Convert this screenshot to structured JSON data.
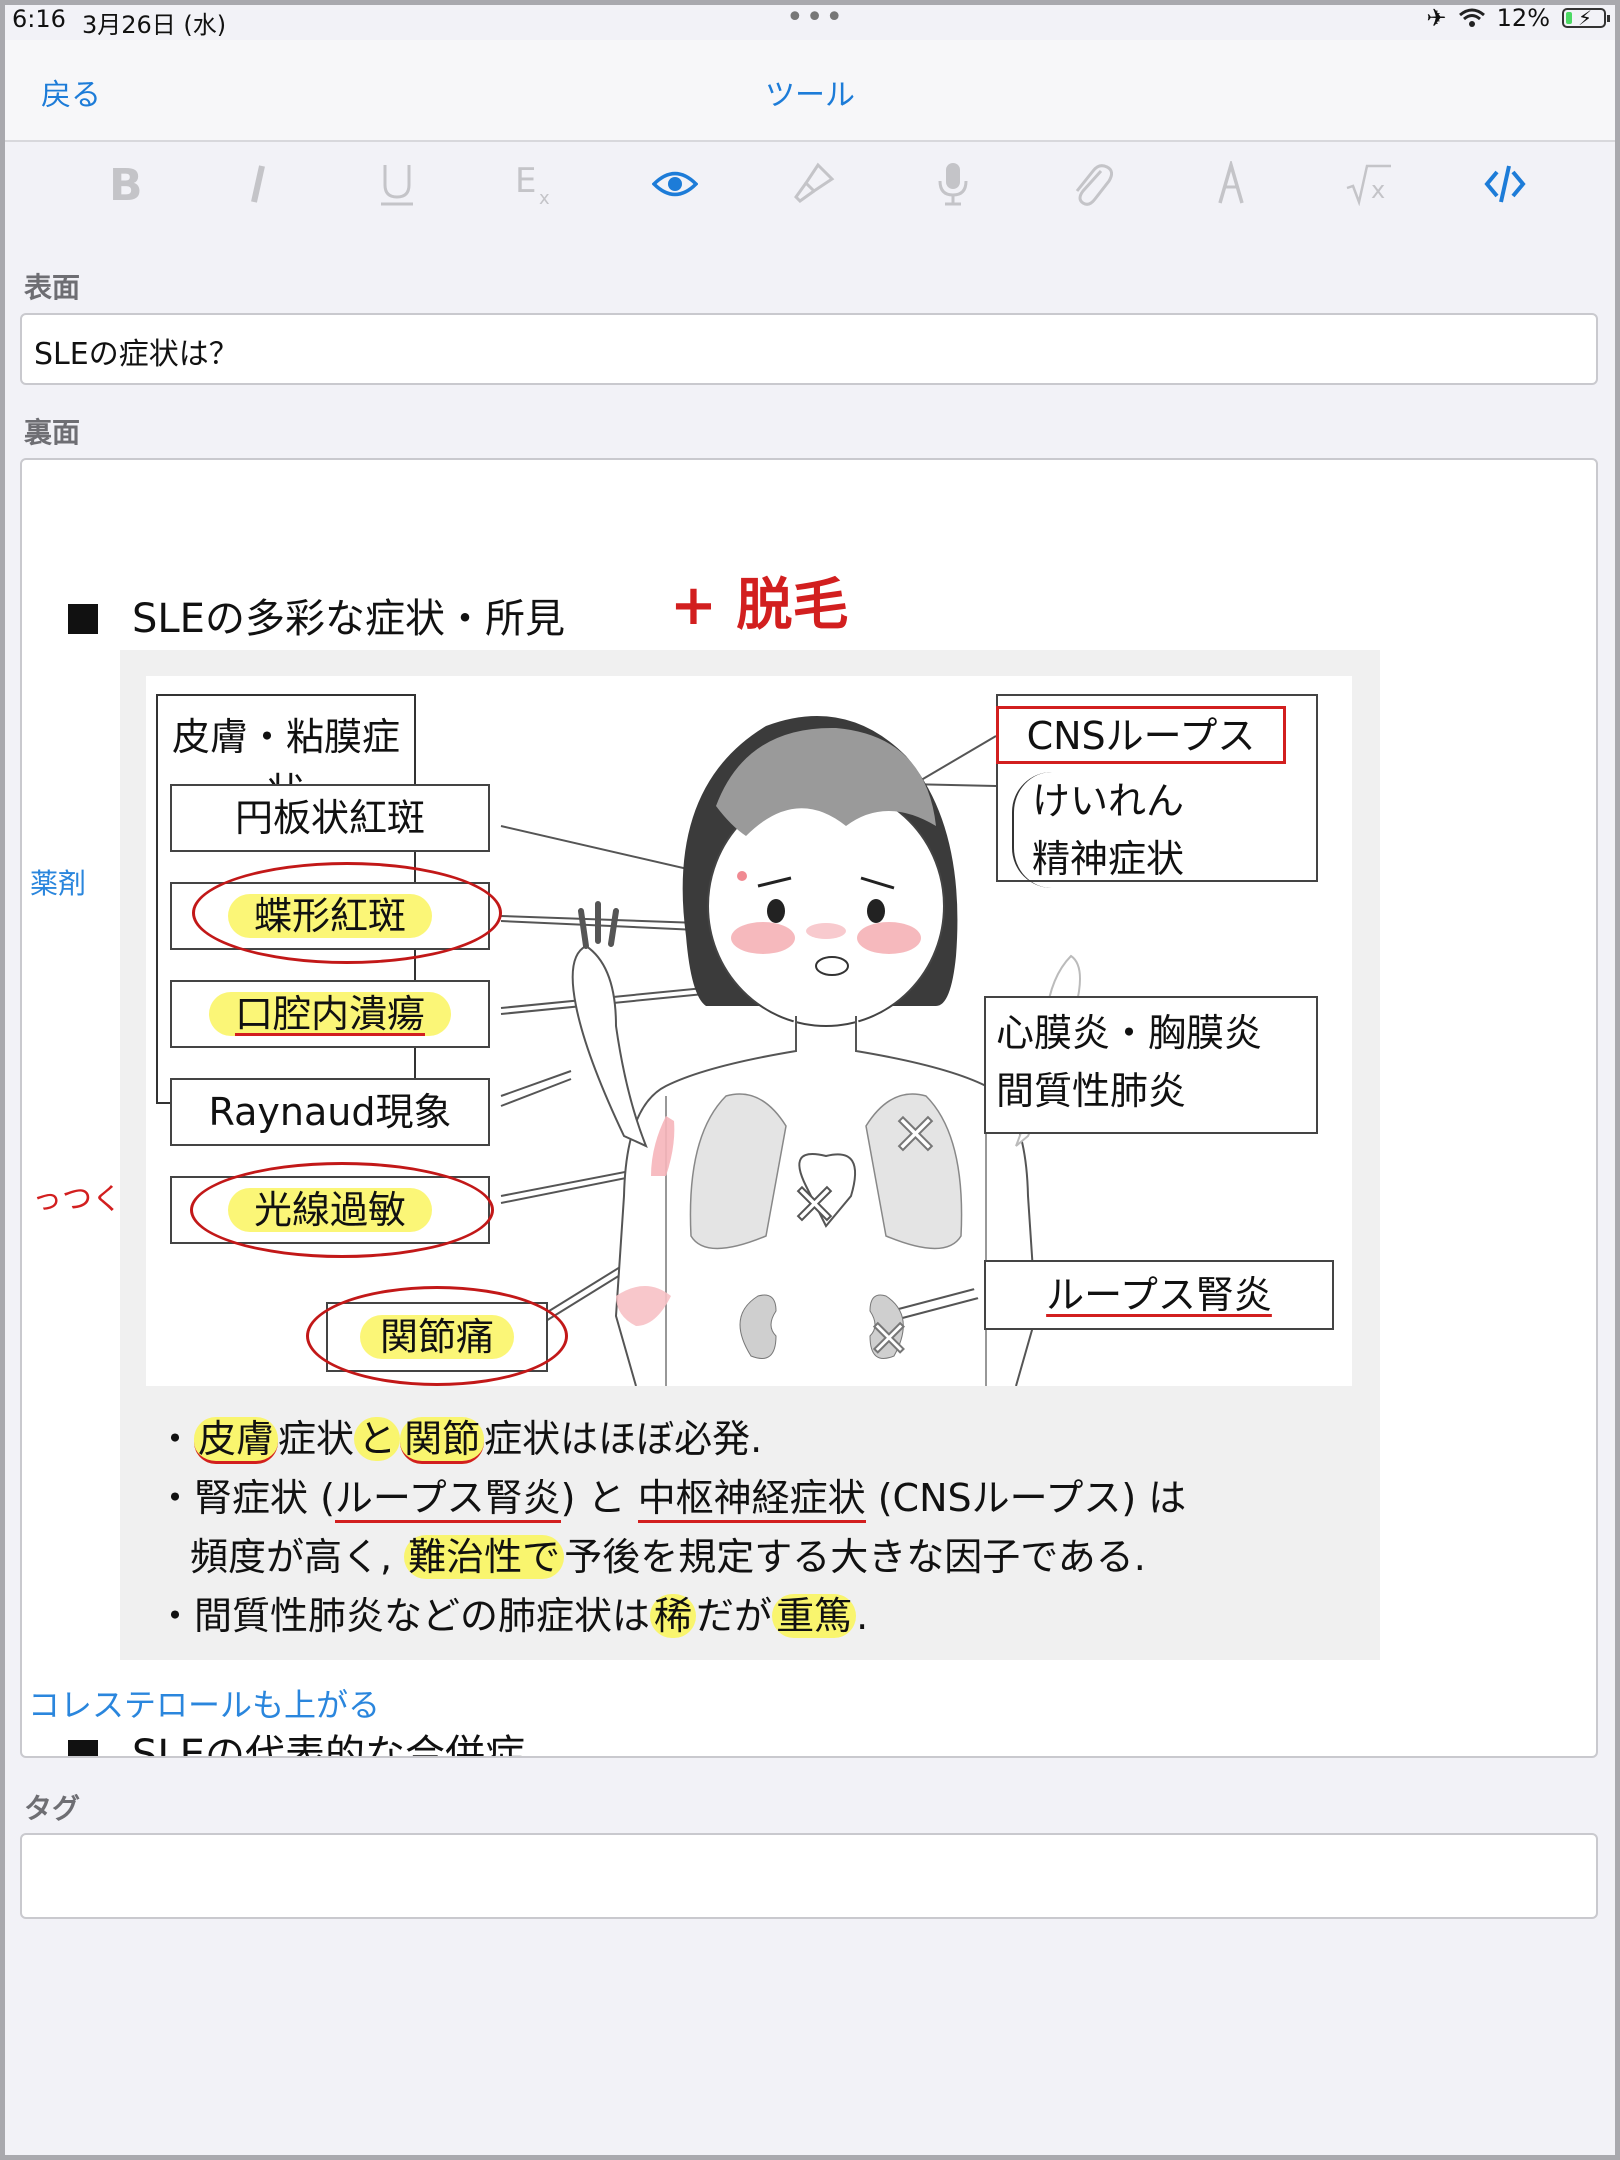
{
  "status": {
    "time": "6:16",
    "date": "3月26日 (水)",
    "dots": "•••",
    "battery": "12%",
    "battery_level": 0.12
  },
  "nav": {
    "back": "戻る",
    "title": "ツール"
  },
  "toolbar": {
    "icons": [
      "bold-icon",
      "italic-icon",
      "underline-icon",
      "clear-format-icon",
      "eye-icon",
      "brush-icon",
      "microphone-icon",
      "paperclip-icon",
      "pen-icon",
      "sqrt-icon",
      "code-icon"
    ]
  },
  "front": {
    "label": "表面",
    "value": "SLEの症状は？"
  },
  "back": {
    "label": "裏面",
    "margin_notes": {
      "left1": "薬剤",
      "left2": "っつく",
      "bottom": "コレステロールも上がる"
    },
    "handwritten": "+ 脱毛",
    "heading": "SLEの多彩な症状・所見",
    "next_heading": "SLEの代表的な合併症",
    "figure": {
      "skin_group": "皮膚・粘膜症状",
      "skin_items": [
        "円板状紅斑",
        "蝶形紅斑",
        "口腔内潰瘍",
        "Raynaud現象",
        "光線過敏"
      ],
      "joint": "関節痛",
      "cns": "CNSループス",
      "cns_sub": [
        "けいれん",
        "精神症状"
      ],
      "heart_lung": [
        "心膜炎・胸膜炎",
        "間質性肺炎"
      ],
      "kidney": "ループス腎炎"
    },
    "bullets": {
      "b1": [
        "皮膚",
        "症状",
        "と",
        "関節",
        "症状はほぼ必発."
      ],
      "b2": [
        "腎症状 (",
        "ループス腎炎",
        ") と ",
        "中枢神経症状",
        " (CNSループス) は"
      ],
      "b3": [
        "頻度が高く, ",
        "難治性で",
        "予後を規定する大きな因子である."
      ],
      "b4": [
        "間質性肺炎などの肺症状は",
        "稀",
        "だが",
        "重篤",
        "."
      ]
    }
  },
  "tags": {
    "label": "タグ",
    "value": ""
  }
}
